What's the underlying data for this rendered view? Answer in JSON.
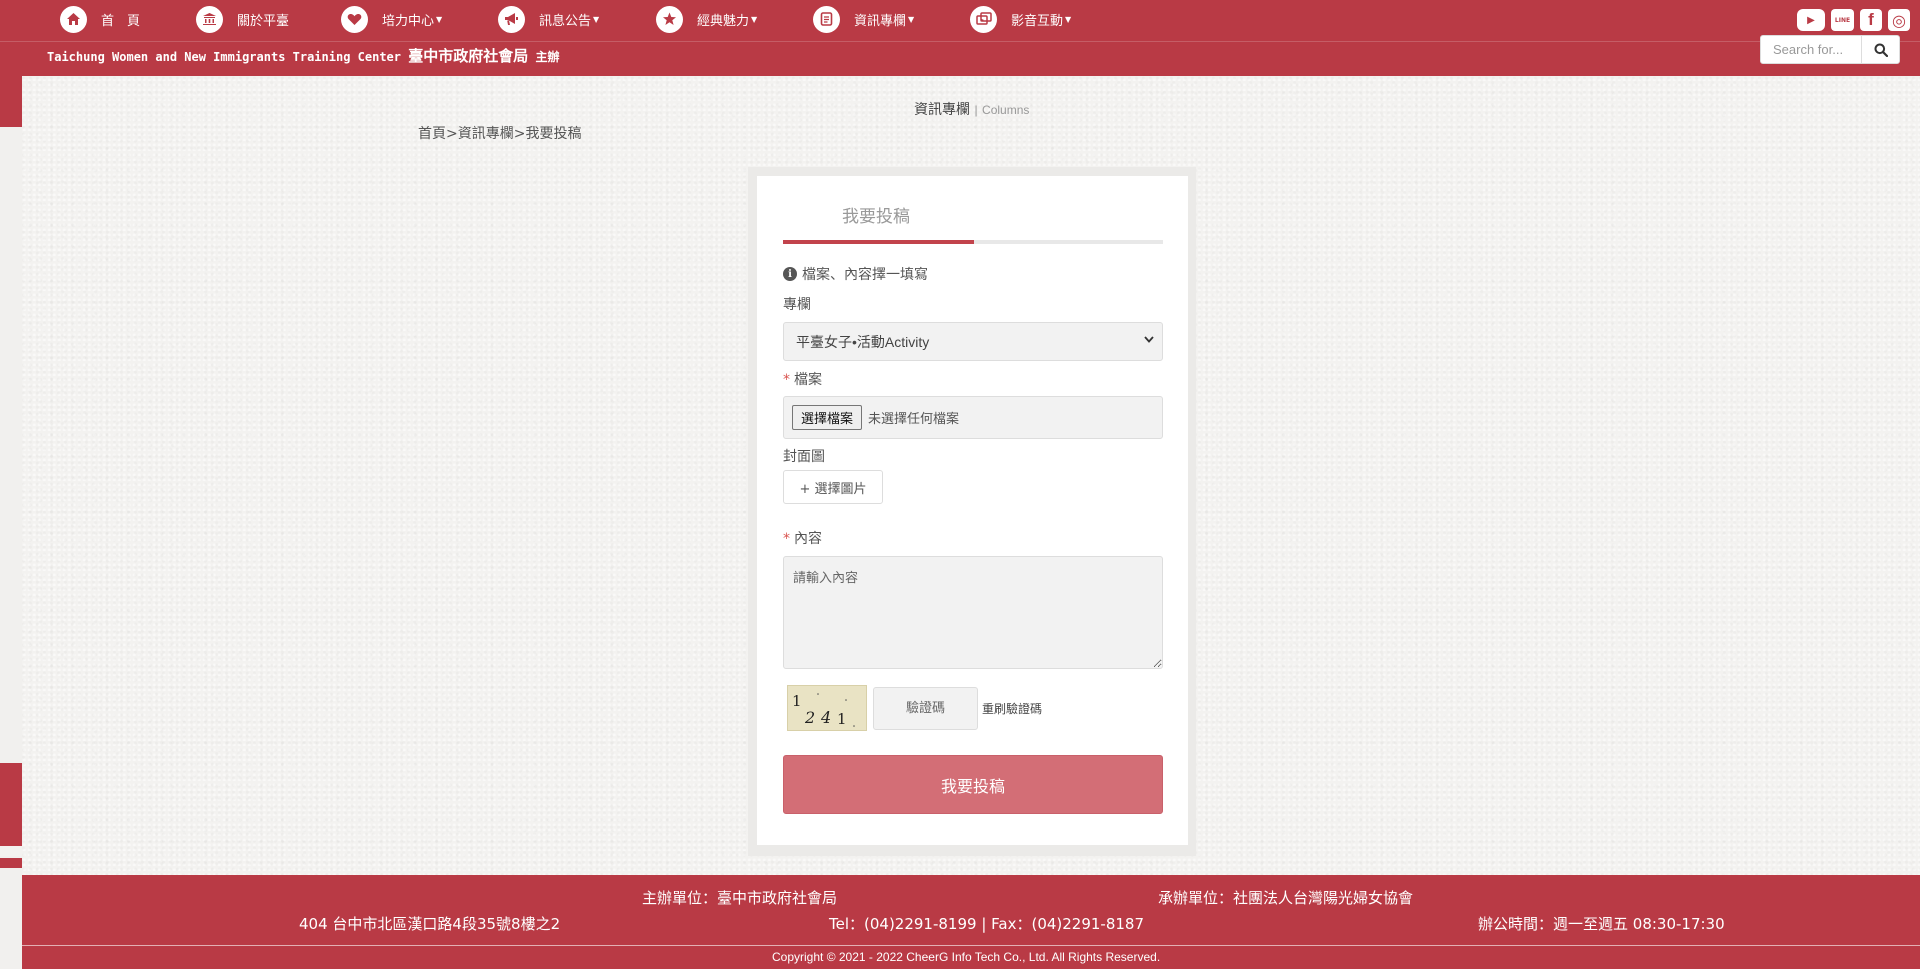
{
  "nav": {
    "items": [
      {
        "icon": "home-icon",
        "label": "首　頁",
        "caret": false
      },
      {
        "icon": "bank-icon",
        "label": "關於平臺",
        "caret": false
      },
      {
        "icon": "heart-icon",
        "label": "培力中心",
        "caret": true
      },
      {
        "icon": "megaphone-icon",
        "label": "訊息公告",
        "caret": true
      },
      {
        "icon": "star-icon",
        "label": "經典魅力",
        "caret": true
      },
      {
        "icon": "document-icon",
        "label": "資訊專欄",
        "caret": true
      },
      {
        "icon": "media-icon",
        "label": "影音互動",
        "caret": true
      }
    ],
    "social": [
      {
        "icon": "youtube-icon",
        "glyph": "▶"
      },
      {
        "icon": "line-icon",
        "glyph": "LINE"
      },
      {
        "icon": "facebook-icon",
        "glyph": "f"
      },
      {
        "icon": "instagram-icon",
        "glyph": "◎"
      }
    ]
  },
  "header": {
    "subtitle_en": "Taichung Women and New Immigrants Training Center",
    "subtitle_zh": "臺中市政府社會局",
    "subtitle_suffix": "主辦"
  },
  "search": {
    "placeholder": "Search for..."
  },
  "page": {
    "title": "資訊專欄",
    "title_sep": "|",
    "title_en": "Columns",
    "breadcrumb": [
      "首頁",
      "資訊專欄",
      "我要投稿"
    ],
    "breadcrumb_sep": ">"
  },
  "form": {
    "tab_label": "我要投稿",
    "note": "檔案、內容擇一填寫",
    "column_label": "專欄",
    "column_selected": "平臺女子•活動Activity",
    "file_label": "檔案",
    "file_button": "選擇檔案",
    "file_status": "未選擇任何檔案",
    "cover_label": "封面圖",
    "cover_button": "+ 選擇圖片",
    "content_label": "內容",
    "content_placeholder": "請輸入內容",
    "captcha_text": "1241",
    "captcha_placeholder": "驗證碼",
    "refresh_label": "重刷驗證碼",
    "submit_label": "我要投稿",
    "required_mark": "*"
  },
  "footer": {
    "organizer": "主辦單位：臺中市政府社會局",
    "contractor": "承辦單位：社團法人台灣陽光婦女協會",
    "address": "404 台中市北區漢口路4段35號8樓之2",
    "phone": "Tel：(04)2291-8199 | Fax：(04)2291-8187",
    "hours": "辦公時間：週一至週五 08:30-17:30",
    "copyright": "Copyright © 2021 - 2022 CheerG Info Tech Co., Ltd. All Rights Reserved."
  },
  "colors": {
    "primary": "#b93a45",
    "submit": "#d36e76",
    "tab_active": "#c2434c"
  }
}
